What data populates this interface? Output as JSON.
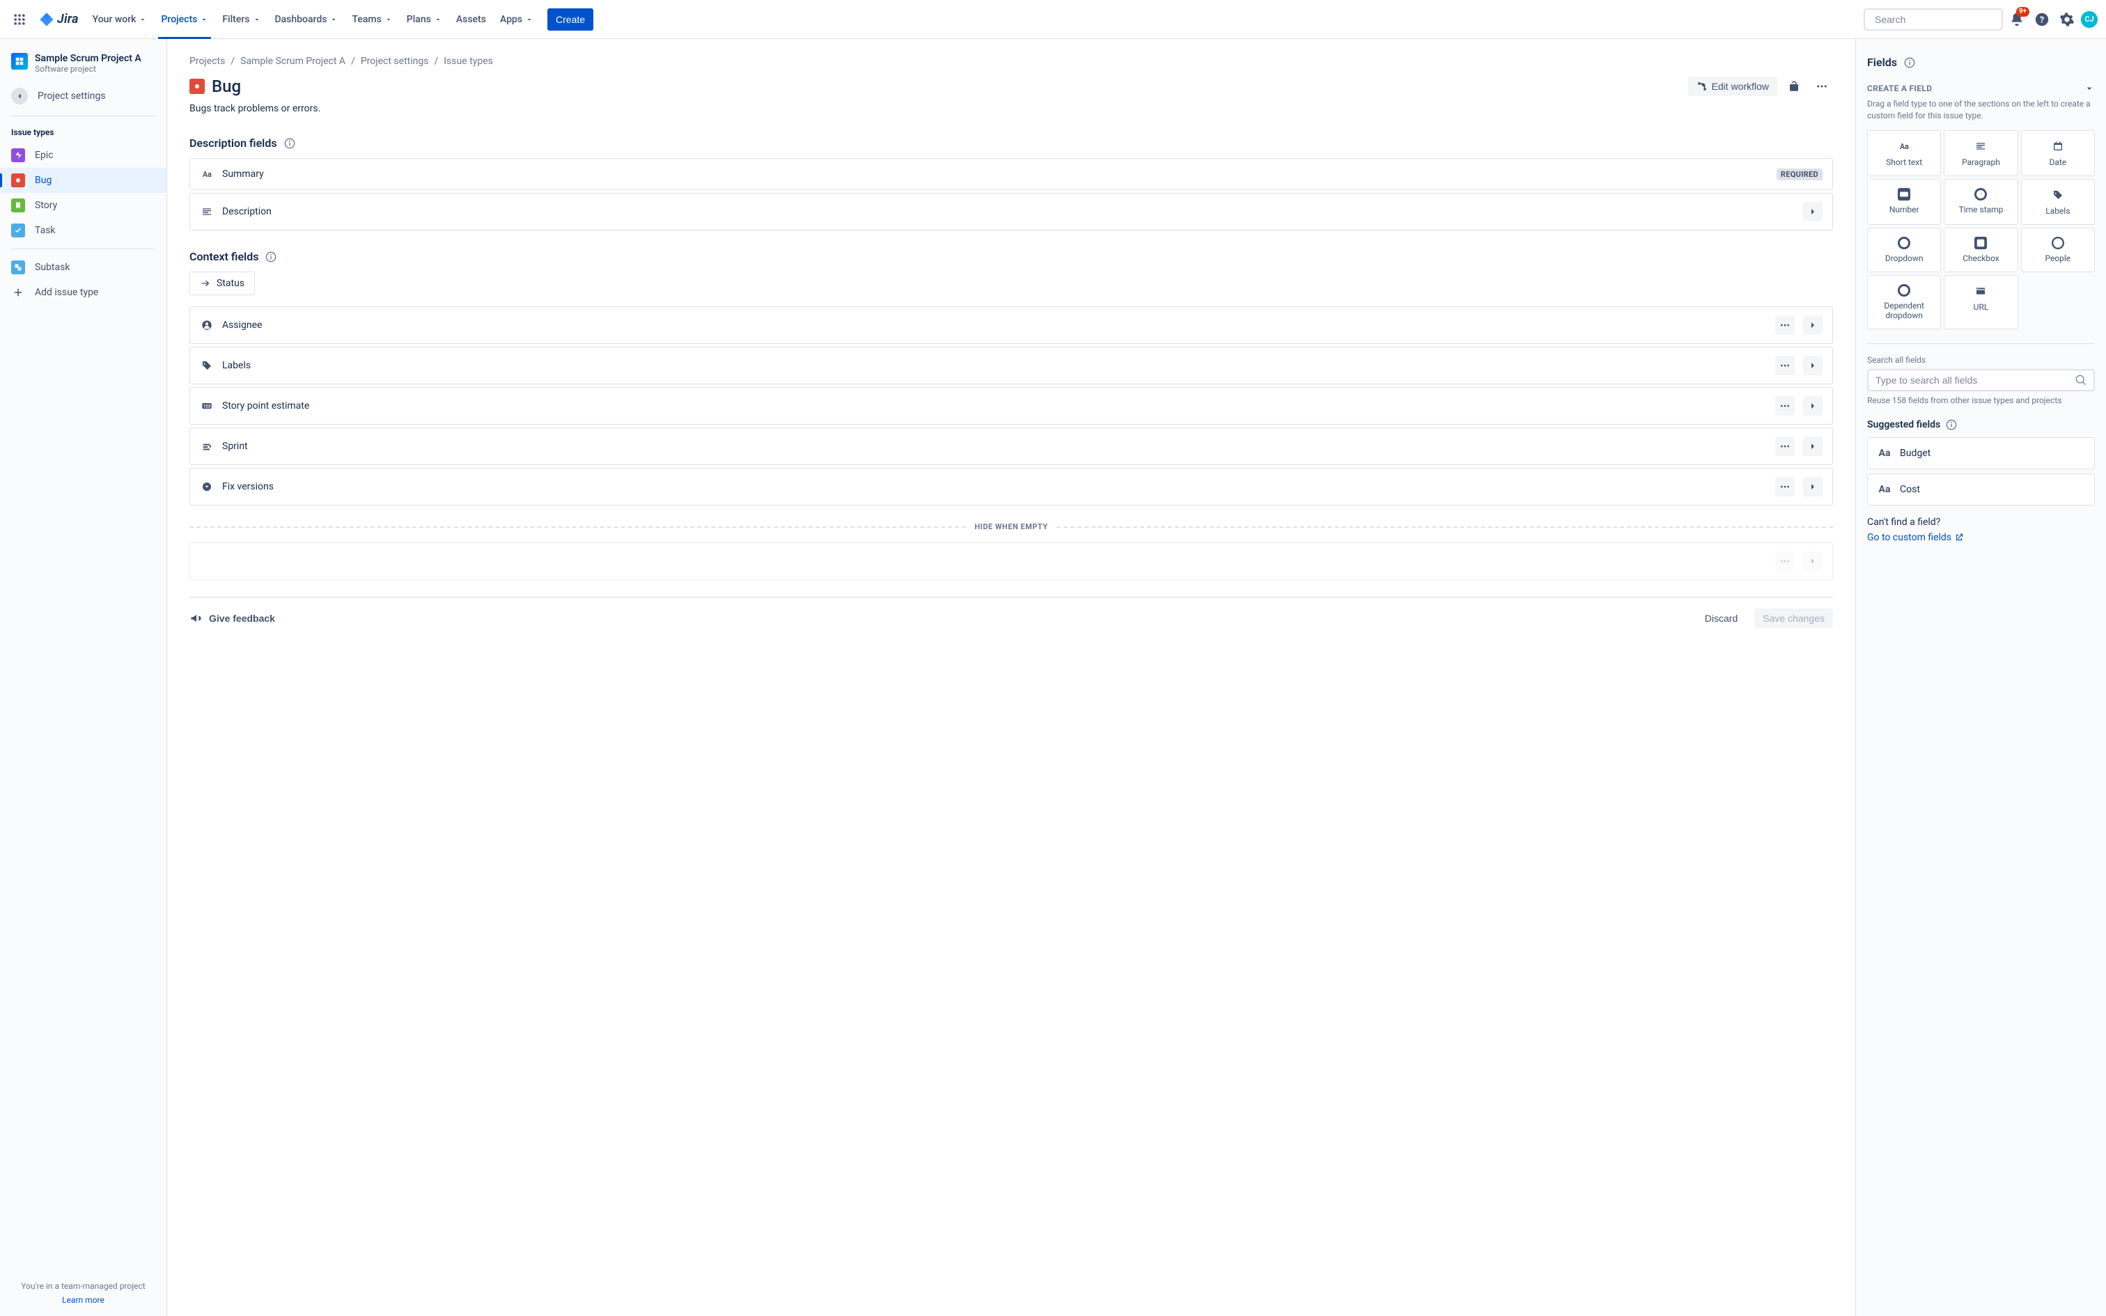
{
  "topnav": {
    "items": [
      "Your work",
      "Projects",
      "Filters",
      "Dashboards",
      "Teams",
      "Plans",
      "Assets",
      "Apps"
    ],
    "active_index": 1,
    "has_chevron": [
      true,
      true,
      true,
      true,
      true,
      true,
      false,
      true
    ],
    "create_label": "Create",
    "search_placeholder": "Search",
    "notif_badge": "9+",
    "avatar_initials": "CJ"
  },
  "sidebar": {
    "project_name": "Sample Scrum Project A",
    "project_type": "Software project",
    "back_label": "Project settings",
    "section_title": "Issue types",
    "issue_types": [
      {
        "name": "Epic",
        "icon": "epic"
      },
      {
        "name": "Bug",
        "icon": "bug"
      },
      {
        "name": "Story",
        "icon": "story"
      },
      {
        "name": "Task",
        "icon": "task"
      }
    ],
    "selected_index": 1,
    "extra_types": [
      {
        "name": "Subtask",
        "icon": "subtask"
      }
    ],
    "add_label": "Add issue type",
    "footer_text": "You're in a team-managed project",
    "footer_link": "Learn more"
  },
  "breadcrumbs": [
    "Projects",
    "Sample Scrum Project A",
    "Project settings",
    "Issue types"
  ],
  "page": {
    "title": "Bug",
    "description": "Bugs track problems or errors.",
    "edit_workflow_label": "Edit workflow"
  },
  "sections": {
    "description": {
      "title": "Description fields",
      "fields": [
        {
          "name": "Summary",
          "icon": "text",
          "required": true,
          "expandable": false
        },
        {
          "name": "Description",
          "icon": "paragraph",
          "required": false,
          "expandable": true
        }
      ]
    },
    "context": {
      "title": "Context fields",
      "status_label": "Status",
      "fields": [
        {
          "name": "Assignee",
          "icon": "person",
          "more": true,
          "expandable": true
        },
        {
          "name": "Labels",
          "icon": "tag",
          "more": true,
          "expandable": true
        },
        {
          "name": "Story point estimate",
          "icon": "number",
          "more": true,
          "expandable": true
        },
        {
          "name": "Sprint",
          "icon": "sprint",
          "more": true,
          "expandable": true
        },
        {
          "name": "Fix versions",
          "icon": "dropdown",
          "more": true,
          "expandable": true
        }
      ],
      "hide_label": "HIDE WHEN EMPTY"
    }
  },
  "footer": {
    "feedback_label": "Give feedback",
    "discard_label": "Discard",
    "save_label": "Save changes"
  },
  "right_panel": {
    "title": "Fields",
    "create_title": "CREATE A FIELD",
    "create_desc": "Drag a field type to one of the sections on the left to create a custom field for this issue type.",
    "field_types": [
      {
        "name": "Short text",
        "icon": "text"
      },
      {
        "name": "Paragraph",
        "icon": "paragraph"
      },
      {
        "name": "Date",
        "icon": "date"
      },
      {
        "name": "Number",
        "icon": "number"
      },
      {
        "name": "Time stamp",
        "icon": "clock"
      },
      {
        "name": "Labels",
        "icon": "tag"
      },
      {
        "name": "Dropdown",
        "icon": "dropdown"
      },
      {
        "name": "Checkbox",
        "icon": "checkbox"
      },
      {
        "name": "People",
        "icon": "person"
      },
      {
        "name": "Dependent dropdown",
        "icon": "dep-dropdown"
      },
      {
        "name": "URL",
        "icon": "url"
      }
    ],
    "search_label": "Search all fields",
    "search_placeholder": "Type to search all fields",
    "reuse_hint": "Reuse 158 fields from other issue types and projects",
    "suggested_title": "Suggested fields",
    "suggested": [
      {
        "name": "Budget",
        "icon": "text"
      },
      {
        "name": "Cost",
        "icon": "text"
      }
    ],
    "cant_find": "Can't find a field?",
    "custom_link": "Go to custom fields"
  }
}
